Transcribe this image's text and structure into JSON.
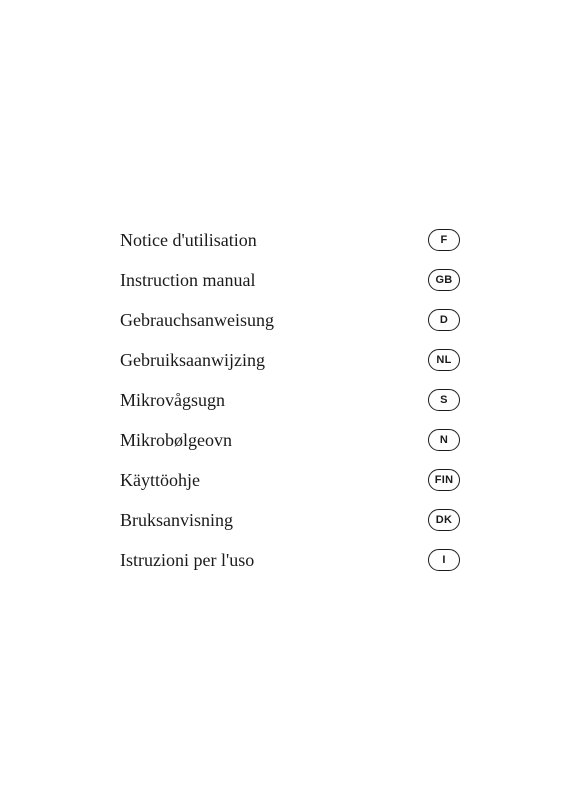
{
  "page": {
    "background": "#ffffff"
  },
  "languages": [
    {
      "label": "Notice d'utilisation",
      "badge": "F"
    },
    {
      "label": "Instruction manual",
      "badge": "GB"
    },
    {
      "label": "Gebrauchsanweisung",
      "badge": "D"
    },
    {
      "label": "Gebruiksaanwijzing",
      "badge": "NL"
    },
    {
      "label": "Mikrovågsugn",
      "badge": "S"
    },
    {
      "label": "Mikrobølgeovn",
      "badge": "N"
    },
    {
      "label": "Käyttöohje",
      "badge": "FIN"
    },
    {
      "label": "Bruksanvisning",
      "badge": "DK"
    },
    {
      "label": "Istruzioni per l'uso",
      "badge": "I"
    }
  ]
}
